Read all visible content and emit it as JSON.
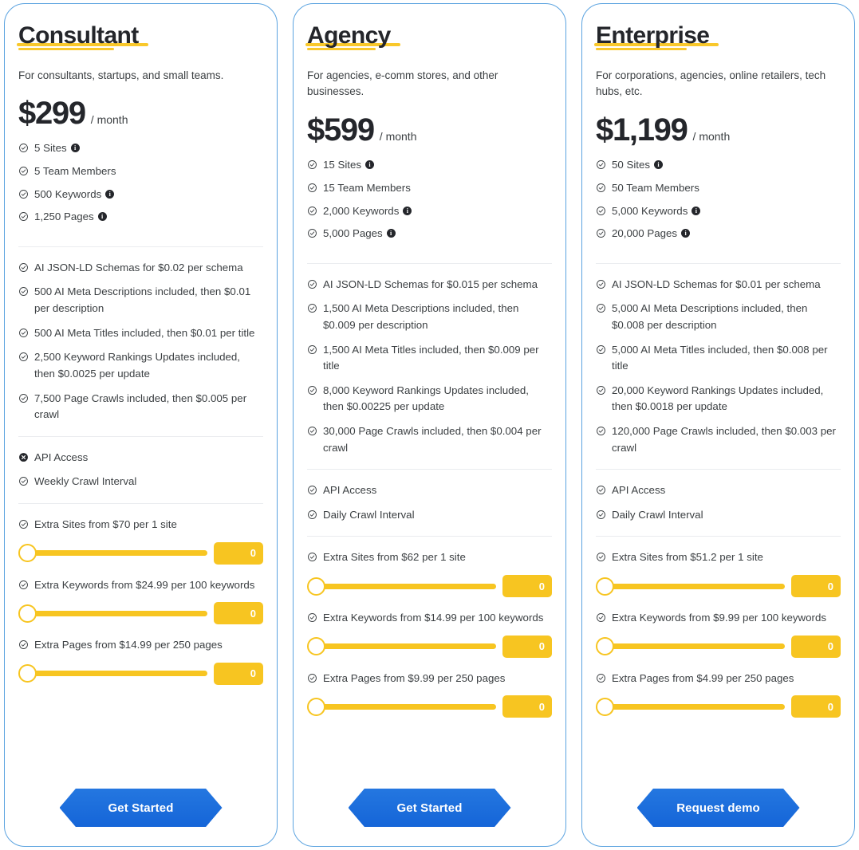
{
  "icons": {
    "check": "check-circle-icon",
    "cross": "cross-circle-icon",
    "info": "info-icon",
    "info_glyph": "i"
  },
  "colors": {
    "card_border": "#5ba3e0",
    "accent_yellow": "#f7c521",
    "cta_blue": "#1565d8",
    "text_dark": "#24262b",
    "text_body": "#3c4043",
    "divider": "#eaecef"
  },
  "plans": [
    {
      "id": "consultant",
      "title": "Consultant",
      "description": "For consultants, startups, and small teams.",
      "price": "$299",
      "period": "/ month",
      "quotas": [
        {
          "text": "5 Sites",
          "icon": "check",
          "info": true
        },
        {
          "text": "5 Team Members",
          "icon": "check",
          "info": false
        },
        {
          "text": "500 Keywords",
          "icon": "check",
          "info": true
        },
        {
          "text": "1,250 Pages",
          "icon": "check",
          "info": true
        }
      ],
      "usage": [
        {
          "text": "AI JSON-LD Schemas for $0.02 per schema",
          "icon": "check"
        },
        {
          "text": "500 AI Meta Descriptions included, then $0.01 per description",
          "icon": "check"
        },
        {
          "text": "500 AI Meta Titles included, then $0.01 per title",
          "icon": "check"
        },
        {
          "text": "2,500 Keyword Rankings Updates included, then $0.0025 per update",
          "icon": "check"
        },
        {
          "text": "7,500 Page Crawls included, then $0.005 per crawl",
          "icon": "check"
        }
      ],
      "access": [
        {
          "text": "API Access",
          "icon": "cross"
        },
        {
          "text": "Weekly Crawl Interval",
          "icon": "check"
        }
      ],
      "addons": [
        {
          "label": "Extra Sites from $70 per 1 site",
          "icon": "check",
          "value": "0"
        },
        {
          "label": "Extra Keywords from $24.99 per 100 keywords",
          "icon": "check",
          "value": "0"
        },
        {
          "label": "Extra Pages from $14.99 per 250 pages",
          "icon": "check",
          "value": "0"
        }
      ],
      "cta": "Get Started"
    },
    {
      "id": "agency",
      "title": "Agency",
      "description": "For agencies, e-comm stores, and other businesses.",
      "price": "$599",
      "period": "/ month",
      "quotas": [
        {
          "text": "15 Sites",
          "icon": "check",
          "info": true
        },
        {
          "text": "15 Team Members",
          "icon": "check",
          "info": false
        },
        {
          "text": "2,000 Keywords",
          "icon": "check",
          "info": true
        },
        {
          "text": "5,000 Pages",
          "icon": "check",
          "info": true
        }
      ],
      "usage": [
        {
          "text": "AI JSON-LD Schemas for $0.015 per schema",
          "icon": "check"
        },
        {
          "text": "1,500 AI Meta Descriptions included, then $0.009 per description",
          "icon": "check"
        },
        {
          "text": "1,500 AI Meta Titles included, then $0.009 per title",
          "icon": "check"
        },
        {
          "text": "8,000 Keyword Rankings Updates included, then $0.00225 per update",
          "icon": "check"
        },
        {
          "text": "30,000 Page Crawls included, then $0.004 per crawl",
          "icon": "check"
        }
      ],
      "access": [
        {
          "text": "API Access",
          "icon": "check"
        },
        {
          "text": "Daily Crawl Interval",
          "icon": "check"
        }
      ],
      "addons": [
        {
          "label": "Extra Sites from $62 per 1 site",
          "icon": "check",
          "value": "0"
        },
        {
          "label": "Extra Keywords from $14.99 per 100 keywords",
          "icon": "check",
          "value": "0"
        },
        {
          "label": "Extra Pages from $9.99 per 250 pages",
          "icon": "check",
          "value": "0"
        }
      ],
      "cta": "Get Started"
    },
    {
      "id": "enterprise",
      "title": "Enterprise",
      "description": "For corporations, agencies, online retailers, tech hubs, etc.",
      "price": "$1,199",
      "period": "/ month",
      "quotas": [
        {
          "text": "50 Sites",
          "icon": "check",
          "info": true
        },
        {
          "text": "50 Team Members",
          "icon": "check",
          "info": false
        },
        {
          "text": "5,000 Keywords",
          "icon": "check",
          "info": true
        },
        {
          "text": "20,000 Pages",
          "icon": "check",
          "info": true
        }
      ],
      "usage": [
        {
          "text": "AI JSON-LD Schemas for $0.01 per schema",
          "icon": "check"
        },
        {
          "text": "5,000 AI Meta Descriptions included, then $0.008 per description",
          "icon": "check"
        },
        {
          "text": "5,000 AI Meta Titles included, then $0.008 per title",
          "icon": "check"
        },
        {
          "text": "20,000 Keyword Rankings Updates included, then $0.0018 per update",
          "icon": "check"
        },
        {
          "text": "120,000 Page Crawls included, then $0.003 per crawl",
          "icon": "check"
        }
      ],
      "access": [
        {
          "text": "API Access",
          "icon": "check"
        },
        {
          "text": "Daily Crawl Interval",
          "icon": "check"
        }
      ],
      "addons": [
        {
          "label": "Extra Sites from $51.2 per 1 site",
          "icon": "check",
          "value": "0"
        },
        {
          "label": "Extra Keywords from $9.99 per 100 keywords",
          "icon": "check",
          "value": "0"
        },
        {
          "label": "Extra Pages from $4.99 per 250 pages",
          "icon": "check",
          "value": "0"
        }
      ],
      "cta": "Request demo"
    }
  ]
}
